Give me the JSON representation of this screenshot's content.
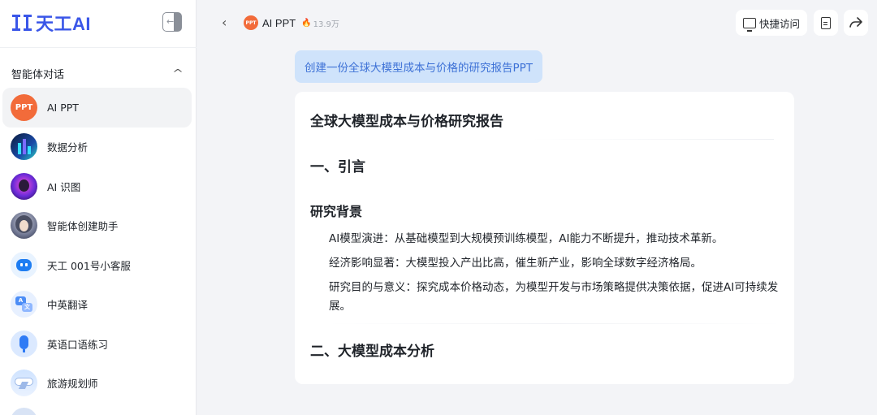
{
  "app": {
    "logo_text": "天工AI"
  },
  "sidebar": {
    "section_title": "智能体对话",
    "items": [
      {
        "label": "AI PPT",
        "avatar_text": "PPT",
        "active": true
      },
      {
        "label": "数据分析"
      },
      {
        "label": "AI 识图"
      },
      {
        "label": "智能体创建助手"
      },
      {
        "label": "天工 001号小客服"
      },
      {
        "label": "中英翻译",
        "badge_a": "A",
        "badge_b": "文"
      },
      {
        "label": "英语口语练习"
      },
      {
        "label": "旅游规划师"
      }
    ]
  },
  "topbar": {
    "agent_name": "AI PPT",
    "agent_avatar_text": "PPT",
    "fire_glyph": "🔥",
    "heat_count": "13.9万",
    "quick_access_label": "快捷访问"
  },
  "chat": {
    "user_message": "创建一份全球大模型成本与价格的研究报告PPT",
    "answer": {
      "title": "全球大模型成本与价格研究报告",
      "section1": "一、引言",
      "subsection": "研究背景",
      "paragraphs": [
        "AI模型演进：从基础模型到大规模预训练模型，AI能力不断提升，推动技术革新。",
        "经济影响显著：大模型投入产出比高，催生新产业，影响全球数字经济格局。",
        "研究目的与意义：探究成本价格动态，为模型开发与市场策略提供决策依据，促进AI可持续发展。"
      ],
      "section2": "二、大模型成本分析"
    }
  },
  "colors": {
    "brand": "#3a56e8",
    "ppt_avatar": "#f26b3a",
    "user_bubble_bg": "#cfe3fb",
    "user_bubble_text": "#3d71d6"
  }
}
